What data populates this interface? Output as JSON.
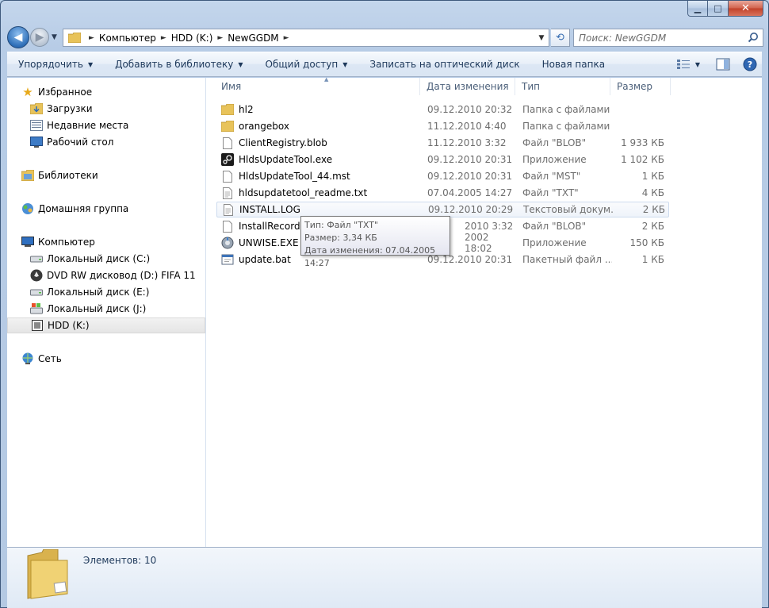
{
  "window": {
    "caption": {
      "minimize": "▁",
      "maximize": "□",
      "close": "✕"
    }
  },
  "address": {
    "crumbs": [
      "Компьютер",
      "HDD (K:)",
      "NewGGDM"
    ]
  },
  "search": {
    "placeholder": "Поиск: NewGGDM"
  },
  "toolbar": {
    "organize": "Упорядочить",
    "add_to_library": "Добавить в библиотеку",
    "share": "Общий доступ",
    "burn": "Записать на оптический диск",
    "new_folder": "Новая папка"
  },
  "nav": {
    "favorites": "Избранное",
    "downloads": "Загрузки",
    "recent": "Недавние места",
    "desktop": "Рабочий стол",
    "libraries": "Библиотеки",
    "homegroup": "Домашняя группа",
    "computer": "Компьютер",
    "drive_c": "Локальный диск (C:)",
    "drive_d": "DVD RW дисковод (D:) FIFA 11",
    "drive_e": "Локальный диск (E:)",
    "drive_j": "Локальный диск  (J:)",
    "drive_k": "HDD (K:)",
    "network": "Сеть"
  },
  "columns": {
    "name": "Имя",
    "date": "Дата изменения",
    "type": "Тип",
    "size": "Размер"
  },
  "files": [
    {
      "name": "hl2",
      "date": "09.12.2010 20:32",
      "type": "Папка с файлами",
      "size": "",
      "icon": "folder-icon"
    },
    {
      "name": "orangebox",
      "date": "11.12.2010 4:40",
      "type": "Папка с файлами",
      "size": "",
      "icon": "folder-icon"
    },
    {
      "name": "ClientRegistry.blob",
      "date": "11.12.2010 3:32",
      "type": "Файл \"BLOB\"",
      "size": "1 933 КБ",
      "icon": "file-icon"
    },
    {
      "name": "HldsUpdateTool.exe",
      "date": "09.12.2010 20:31",
      "type": "Приложение",
      "size": "1 102 КБ",
      "icon": "steam-icon"
    },
    {
      "name": "HldsUpdateTool_44.mst",
      "date": "09.12.2010 20:31",
      "type": "Файл \"MST\"",
      "size": "1 КБ",
      "icon": "file-icon"
    },
    {
      "name": "hldsupdatetool_readme.txt",
      "date": "07.04.2005 14:27",
      "type": "Файл \"TXT\"",
      "size": "4 КБ",
      "icon": "text-file-icon"
    },
    {
      "name": "INSTALL.LOG",
      "date": "09.12.2010 20:29",
      "type": "Текстовый докум...",
      "size": "2 КБ",
      "icon": "text-file-icon"
    },
    {
      "name": "InstallRecord.b",
      "date": "2010 3:32",
      "type": "Файл \"BLOB\"",
      "size": "2 КБ",
      "icon": "file-icon"
    },
    {
      "name": "UNWISE.EXE",
      "date": "2002 18:02",
      "type": "Приложение",
      "size": "150 КБ",
      "icon": "setup-icon"
    },
    {
      "name": "update.bat",
      "date": "09.12.2010 20:31",
      "type": "Пакетный файл ...",
      "size": "1 КБ",
      "icon": "batch-file-icon"
    }
  ],
  "tooltip": {
    "type": "Тип: Файл \"TXT\"",
    "size": "Размер: 3,34 КБ",
    "modified": "Дата изменения: 07.04.2005 14:27"
  },
  "details": {
    "count": "Элементов: 10"
  }
}
